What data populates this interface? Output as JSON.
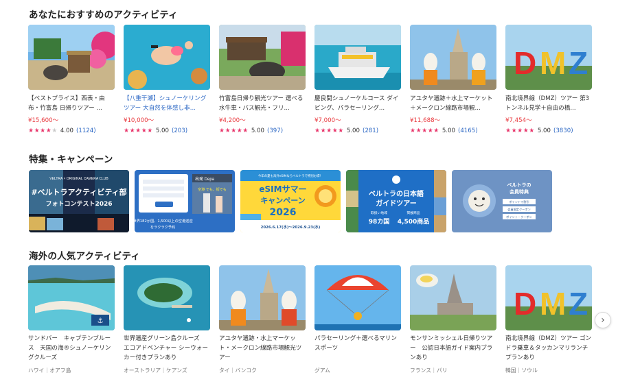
{
  "recommended": {
    "title": "あなたにおすすめのアクティビティ",
    "items": [
      {
        "title": "【ベストプライス】西表・由布・竹富島 日帰りツアー ...",
        "price": "¥15,600～",
        "stars": 4,
        "score": "4.00",
        "count": "(1124)",
        "highlight": false
      },
      {
        "title": "【八重干瀬】シュノーケリングツアー 大自然を体感し非...",
        "price": "¥10,000～",
        "stars": 5,
        "score": "5.00",
        "count": "(203)",
        "highlight": true
      },
      {
        "title": "竹富島日帰り観光ツアー 選べる水牛車・バス観光・フリ...",
        "price": "¥4,200～",
        "stars": 5,
        "score": "5.00",
        "count": "(397)",
        "highlight": false
      },
      {
        "title": "慶良間シュノーケルコース ダイビング、パラセーリング...",
        "price": "¥7,000～",
        "stars": 5,
        "score": "5.00",
        "count": "(281)",
        "highlight": false
      },
      {
        "title": "アユタヤ遺跡＋水上マーケット＋メークロン線路市場観...",
        "price": "¥11,688～",
        "stars": 5,
        "score": "5.00",
        "count": "(4165)",
        "highlight": false
      },
      {
        "title": "南北境界線（DMZ）ツアー 第3トンネル見学＋自由の橋...",
        "price": "¥7,454～",
        "stars": 5,
        "score": "5.00",
        "count": "(3830)",
        "highlight": false
      }
    ]
  },
  "campaign": {
    "title": "特集・キャンペーン",
    "banners": [
      {
        "text1": "#ベルトラアクティビティ部",
        "text2": "フォトコンテスト2026",
        "text3": "VELTRA × ORIGINAL CAMERA CLUB"
      },
      {
        "text1": "世界182か国、1,500以上の空港送迎",
        "text2": "をラクラク予約",
        "text3": "出発 Depa",
        "text4": "空港 でも、街でも"
      },
      {
        "text1": "eSIMサマー",
        "text2": "キャンペーン",
        "text3": "2026",
        "text4": "2026.6.17(水)～2026.9.23(水)",
        "text5": "今年の夏も海外eSIMならベルトラで特別お得！"
      },
      {
        "text1": "ベルトラの日本語",
        "text2": "ガイドツアー",
        "text3": "取扱い地域",
        "text4": "98カ国",
        "text5": "掲載商品",
        "text6": "4,500商品"
      },
      {
        "text1": "ベルトラの",
        "text2": "会員特典",
        "text3": "ポイントで割引",
        "text4": "会員限定クーポン",
        "text5": "ポイント・クーポン"
      }
    ]
  },
  "overseas": {
    "title": "海外の人気アクティビティ",
    "items": [
      {
        "title": "サンドバー　キャプテンブルース　天国の海®シュノーケリングクルーズ",
        "location": "ハワイ｜オアフ島"
      },
      {
        "title": "世界遺産グリーン島クルーズ　エコアドベンチャー シーウォーカー付きプランあり",
        "location": "オーストラリア｜ケアンズ"
      },
      {
        "title": "アユタヤ遺跡・水上マーケット・メークロン線路市場観光ツアー",
        "location": "タイ｜バンコク"
      },
      {
        "title": "パラセーリング＋選べるマリンスポーツ",
        "location": "グアム"
      },
      {
        "title": "モンサンミッシェル日帰りツアー　公認日本語ガイド案内プランあり",
        "location": "フランス｜パリ"
      },
      {
        "title": "南北境界線（DMZ）ツアー ゴンドラ乗車＆タッカンマリランチプランあり",
        "location": "韓国｜ソウル"
      }
    ]
  },
  "icons": {
    "next": "chevron-right-icon"
  },
  "colors": {
    "price": "#e8383d",
    "star": "#e8356a",
    "link": "#2b67c4"
  }
}
